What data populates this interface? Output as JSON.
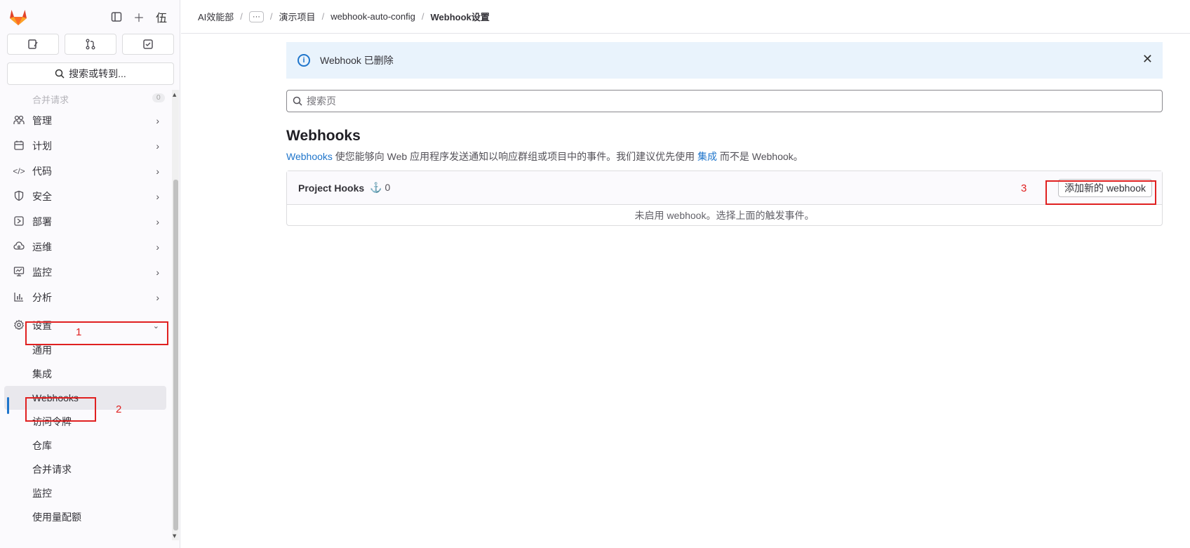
{
  "sidebar": {
    "top_icons": [
      "sidebar-toggle-icon",
      "plus-icon"
    ],
    "avatar_text": "伍",
    "quick_buttons": [
      "issues-icon",
      "merge-request-icon",
      "todo-icon"
    ],
    "search_label": "搜索或转到...",
    "faded_item": {
      "label": "合并请求",
      "count": "0"
    },
    "items": [
      {
        "label": "管理",
        "icon": "users-icon"
      },
      {
        "label": "计划",
        "icon": "calendar-icon"
      },
      {
        "label": "代码",
        "icon": "code-icon"
      },
      {
        "label": "安全",
        "icon": "shield-icon"
      },
      {
        "label": "部署",
        "icon": "deploy-icon"
      },
      {
        "label": "运维",
        "icon": "cloud-icon"
      },
      {
        "label": "监控",
        "icon": "monitor-icon"
      },
      {
        "label": "分析",
        "icon": "chart-icon"
      },
      {
        "label": "设置",
        "icon": "gear-icon"
      }
    ],
    "sub_items": [
      "通用",
      "集成",
      "Webhooks",
      "访问令牌",
      "仓库",
      "合并请求",
      "监控",
      "使用量配额"
    ]
  },
  "breadcrumb": {
    "root": "AI效能部",
    "ellipsis": "···",
    "group": "演示项目",
    "project": "webhook-auto-config",
    "current": "Webhook设置"
  },
  "alert": {
    "text": "Webhook 已删除"
  },
  "search": {
    "placeholder": "搜索页"
  },
  "page": {
    "title": "Webhooks",
    "desc_link1": "Webhooks",
    "desc_mid": " 使您能够向 Web 应用程序发送通知以响应群组或项目中的事件。我们建议优先使用 ",
    "desc_link2": "集成",
    "desc_end": " 而不是 Webhook。"
  },
  "hooks": {
    "name": "Project Hooks",
    "count": "0",
    "add_button": "添加新的 webhook",
    "empty": "未启用 webhook。选择上面的触发事件。"
  },
  "annotations": [
    "1",
    "2",
    "3"
  ],
  "colors": {
    "accent": "#1f75cb",
    "annotation": "#e02020",
    "alert_bg": "#e9f3fc"
  }
}
